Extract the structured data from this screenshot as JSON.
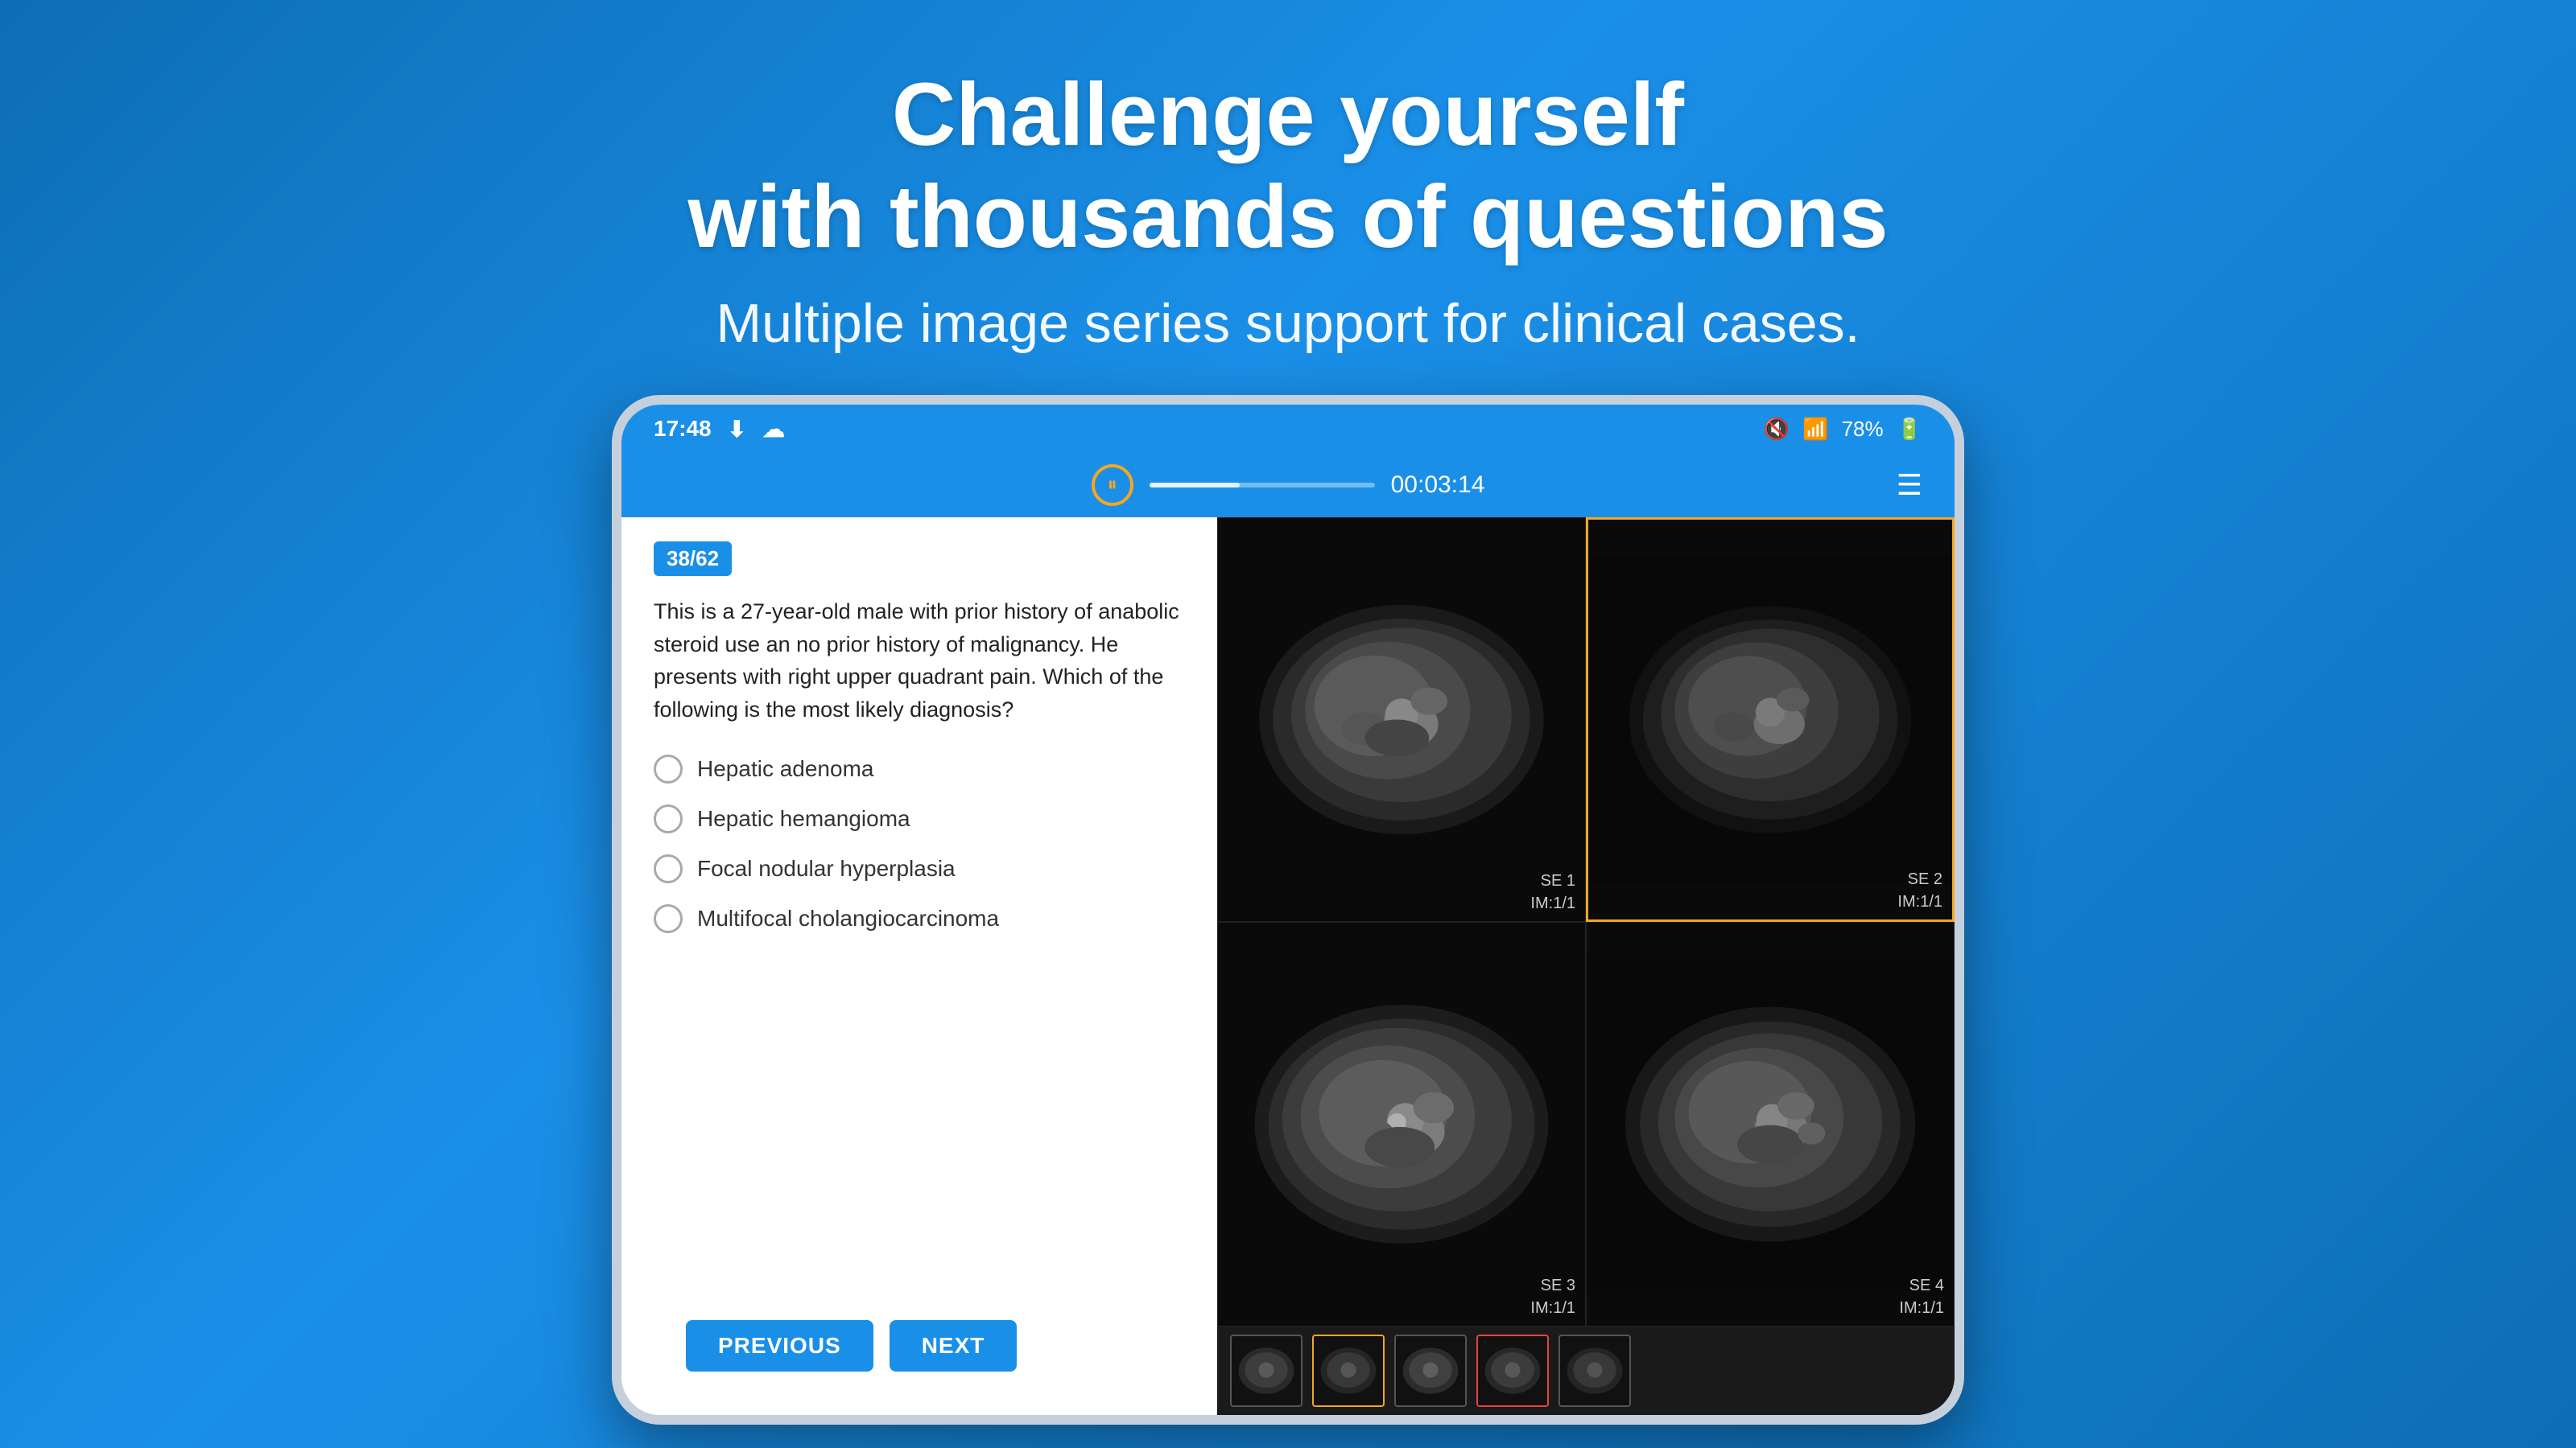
{
  "header": {
    "title_line1": "Challenge yourself",
    "title_line2": "with thousands of questions",
    "subtitle": "Multiple image series support for clinical cases."
  },
  "status_bar": {
    "time": "17:48",
    "battery": "78%",
    "signal_icon": "signal",
    "battery_icon": "battery"
  },
  "toolbar": {
    "pause_icon": "⏸",
    "timer": "00:03:14",
    "menu_icon": "☰"
  },
  "question": {
    "badge": "38/62",
    "text": "This is a 27-year-old male with prior history of anabolic steroid use an no prior history of malignancy. He presents with right upper quadrant pain. Which of the following is the most likely diagnosis?",
    "options": [
      {
        "id": "a",
        "label": "Hepatic adenoma"
      },
      {
        "id": "b",
        "label": "Hepatic hemangioma"
      },
      {
        "id": "c",
        "label": "Focal nodular hyperplasia"
      },
      {
        "id": "d",
        "label": "Multifocal cholangiocarcinoma"
      }
    ]
  },
  "navigation": {
    "previous_label": "PREVIOUS",
    "next_label": "NEXT"
  },
  "images": [
    {
      "id": "SE1",
      "label": "SE 1\nIM:1/1",
      "selected": false
    },
    {
      "id": "SE2",
      "label": "SE 2\nIM:1/1",
      "selected": true
    },
    {
      "id": "SE3",
      "label": "SE 3\nIM:1/1",
      "selected": false
    },
    {
      "id": "SE4",
      "label": "SE 4\nIM:1/1",
      "selected": false
    }
  ],
  "thumbnails": [
    {
      "id": "t1",
      "active": true,
      "color": "none"
    },
    {
      "id": "t2",
      "active": false,
      "color": "orange"
    },
    {
      "id": "t3",
      "active": false,
      "color": "none"
    },
    {
      "id": "t4",
      "active": false,
      "color": "red"
    },
    {
      "id": "t5",
      "active": false,
      "color": "none"
    }
  ]
}
